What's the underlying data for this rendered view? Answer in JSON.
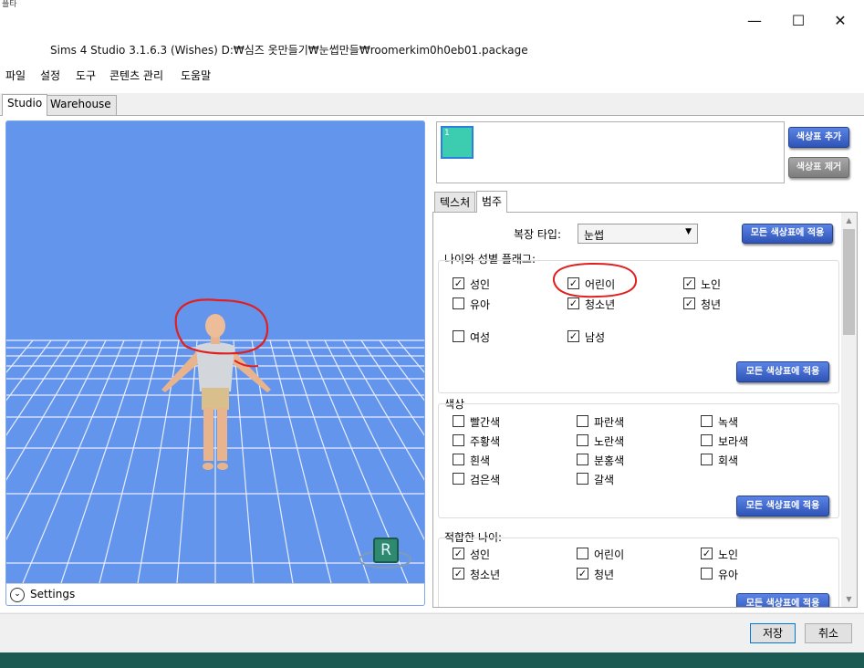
{
  "window": {
    "caption_fragment": "플타",
    "app_title": "Sims 4 Studio 3.1.6.3 (Wishes)  D:₩심즈 옷만들기₩눈썹만들₩roomerkim0h0eb01.package",
    "minimize_glyph": "—",
    "maximize_glyph": "☐",
    "close_glyph": "✕"
  },
  "menu": [
    "파일",
    "설정",
    "도구",
    "콘텐츠 관리",
    "도움말"
  ],
  "main_tabs": {
    "studio": "Studio",
    "warehouse": "Warehouse"
  },
  "viewport": {
    "settings_label": "Settings",
    "settings_glyph": "⌄",
    "reset_badge": "R",
    "colors": {
      "background": "#6495ed",
      "grid": "#e8eefc"
    }
  },
  "swatches": {
    "items": [
      {
        "label": "1",
        "color": "#3ccdb0"
      }
    ],
    "add_button": "색상표 추가",
    "remove_button": "색상표 제거"
  },
  "sub_tabs": {
    "texture": "텍스처",
    "category": "범주"
  },
  "category": {
    "outfit_type_label": "복장 타입:",
    "outfit_type_value": "눈썹",
    "apply_all_label": "모든 색상표에 적용",
    "age_gender": {
      "title": "나이와 성별 플래그:",
      "items": [
        {
          "label": "성인",
          "checked": true
        },
        {
          "label": "어린이",
          "checked": true
        },
        {
          "label": "노인",
          "checked": true
        },
        {
          "label": "유아",
          "checked": false
        },
        {
          "label": "청소년",
          "checked": true
        },
        {
          "label": "청년",
          "checked": true
        },
        {
          "label": "여성",
          "checked": false
        },
        {
          "label": "남성",
          "checked": true
        }
      ]
    },
    "colors": {
      "title": "색상",
      "items": [
        {
          "label": "빨간색",
          "checked": false
        },
        {
          "label": "파란색",
          "checked": false
        },
        {
          "label": "녹색",
          "checked": false
        },
        {
          "label": "주황색",
          "checked": false
        },
        {
          "label": "노란색",
          "checked": false
        },
        {
          "label": "보라색",
          "checked": false
        },
        {
          "label": "흰색",
          "checked": false
        },
        {
          "label": "분홍색",
          "checked": false
        },
        {
          "label": "회색",
          "checked": false
        },
        {
          "label": "검은색",
          "checked": false
        },
        {
          "label": "갈색",
          "checked": false
        }
      ]
    },
    "suitable_age": {
      "title": "적합한 나이:",
      "items": [
        {
          "label": "성인",
          "checked": true
        },
        {
          "label": "어린이",
          "checked": false
        },
        {
          "label": "노인",
          "checked": true
        },
        {
          "label": "청소년",
          "checked": true
        },
        {
          "label": "청년",
          "checked": true
        },
        {
          "label": "유아",
          "checked": false
        }
      ]
    }
  },
  "footer": {
    "save": "저장",
    "cancel": "취소"
  },
  "check_glyph": "✓"
}
